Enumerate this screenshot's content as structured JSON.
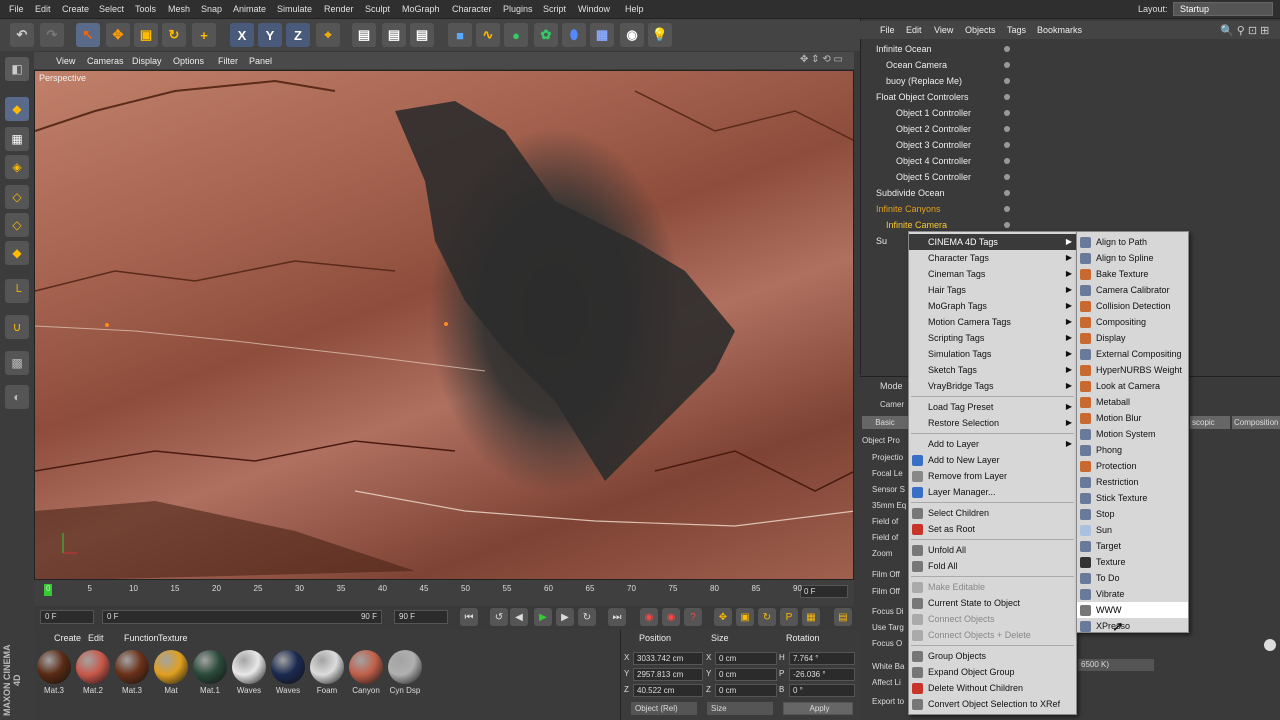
{
  "menubar": {
    "items": [
      "File",
      "Edit",
      "Create",
      "Select",
      "Tools",
      "Mesh",
      "Snap",
      "Animate",
      "Simulate",
      "Render",
      "Sculpt",
      "MoGraph",
      "Character",
      "Plugins",
      "Script",
      "Window",
      "Help"
    ],
    "layout_label": "Layout:",
    "layout_value": "Startup"
  },
  "viewport": {
    "menu": [
      "View",
      "Cameras",
      "Display",
      "Options",
      "Filter",
      "Panel"
    ],
    "label": "Perspective"
  },
  "timeline": {
    "ticks": [
      "0",
      "5",
      "10",
      "15",
      "20",
      "25",
      "30",
      "35",
      "40",
      "45",
      "50",
      "55",
      "60",
      "65",
      "70",
      "75",
      "80",
      "85",
      "90"
    ],
    "end_frame": "0 F"
  },
  "playbar": {
    "start": "0 F",
    "range_start": "0 F",
    "range_end": "90 F",
    "end": "90 F"
  },
  "materials": {
    "menu": [
      "Create",
      "Edit",
      "Function",
      "Texture"
    ],
    "items": [
      {
        "name": "Mat.3",
        "color": "#5a2a14"
      },
      {
        "name": "Mat.2",
        "color": "#c8584a"
      },
      {
        "name": "Mat.3",
        "color": "#6a3018"
      },
      {
        "name": "Mat",
        "color": "#e0a020"
      },
      {
        "name": "Mat.1",
        "color": "#2a4a3a"
      },
      {
        "name": "Waves",
        "color": "#e8e8e8"
      },
      {
        "name": "Waves",
        "color": "#1a2a50"
      },
      {
        "name": "Foam",
        "color": "#dcdcdc"
      },
      {
        "name": "Canyon",
        "color": "#c0604a"
      },
      {
        "name": "Cyn Dsp",
        "color": "#b0b0b0"
      }
    ]
  },
  "coords": {
    "headers": [
      "Position",
      "Size",
      "Rotation"
    ],
    "rows": [
      {
        "axis": "X",
        "pos": "3033.742 cm",
        "saxis": "X",
        "size": "0 cm",
        "raxis": "H",
        "rot": "7.764 °"
      },
      {
        "axis": "Y",
        "pos": "2957.813 cm",
        "saxis": "Y",
        "size": "0 cm",
        "raxis": "P",
        "rot": "-26.036 °"
      },
      {
        "axis": "Z",
        "pos": "40.522 cm",
        "saxis": "Z",
        "size": "0 cm",
        "raxis": "B",
        "rot": "0 °"
      }
    ],
    "mode1": "Object (Rel)",
    "mode2": "Size",
    "apply": "Apply"
  },
  "objmgr": {
    "menu": [
      "File",
      "Edit",
      "View",
      "Objects",
      "Tags",
      "Bookmarks"
    ],
    "rows": [
      "Infinite Ocean",
      "Ocean Camera",
      "buoy (Replace Me)",
      "Float Object Controlers",
      "Object 1 Controller",
      "Object 2 Controller",
      "Object 3 Controller",
      "Object 4 Controller",
      "Object 5 Controller",
      "Subdivide Ocean",
      "Infinite Canyons",
      "Infinite Camera",
      "Su"
    ]
  },
  "attr": {
    "mode": "Mode",
    "camera_tab": "Camer",
    "basic": "Basic",
    "tabs_right": [
      "scopic",
      "Composition"
    ],
    "labels": [
      "Object Pro",
      "Projectio",
      "Focal Le",
      "Sensor S",
      "35mm Eq",
      "Field of",
      "Field of",
      "Zoom",
      "Film Off",
      "Film Off",
      "Focus Di",
      "Use Targ",
      "Focus O",
      "White Ba",
      "Affect Li",
      "Export to"
    ],
    "kelvin": "6500 K)"
  },
  "ctx1": {
    "items": [
      {
        "label": "CINEMA 4D Tags",
        "arrow": true,
        "hl": true
      },
      {
        "label": "Character Tags",
        "arrow": true
      },
      {
        "label": "Cineman Tags",
        "arrow": true
      },
      {
        "label": "Hair Tags",
        "arrow": true
      },
      {
        "label": "MoGraph Tags",
        "arrow": true
      },
      {
        "label": "Motion Camera Tags",
        "arrow": true
      },
      {
        "label": "Scripting Tags",
        "arrow": true
      },
      {
        "label": "Simulation Tags",
        "arrow": true
      },
      {
        "label": "Sketch Tags",
        "arrow": true
      },
      {
        "label": "VrayBridge Tags",
        "arrow": true
      },
      {
        "sep": true
      },
      {
        "label": "Load Tag Preset",
        "arrow": true
      },
      {
        "label": "Restore Selection",
        "arrow": true
      },
      {
        "sep": true
      },
      {
        "label": "Add to Layer",
        "arrow": true
      },
      {
        "label": "Add to New Layer",
        "icon": "#3a6fc8"
      },
      {
        "label": "Remove from Layer",
        "icon": "#888"
      },
      {
        "label": "Layer Manager...",
        "icon": "#3a6fc8"
      },
      {
        "sep": true
      },
      {
        "label": "Select Children",
        "icon": "#777"
      },
      {
        "label": "Set as Root",
        "icon": "#c8342a"
      },
      {
        "sep": true
      },
      {
        "label": "Unfold All",
        "icon": "#777"
      },
      {
        "label": "Fold All",
        "icon": "#777"
      },
      {
        "sep": true
      },
      {
        "label": "Make Editable",
        "dis": true,
        "icon": "#aaa"
      },
      {
        "label": "Current State to Object",
        "icon": "#777"
      },
      {
        "label": "Connect Objects",
        "dis": true,
        "icon": "#aaa"
      },
      {
        "label": "Connect Objects + Delete",
        "dis": true,
        "icon": "#aaa"
      },
      {
        "sep": true
      },
      {
        "label": "Group Objects",
        "icon": "#777"
      },
      {
        "label": "Expand Object Group",
        "icon": "#777"
      },
      {
        "label": "Delete Without Children",
        "icon": "#c8342a"
      },
      {
        "label": "Convert Object Selection to XRef",
        "icon": "#777"
      }
    ]
  },
  "ctx2": {
    "items": [
      {
        "label": "Align to Path",
        "icon": "#6a7a9a"
      },
      {
        "label": "Align to Spline",
        "icon": "#6a7a9a"
      },
      {
        "label": "Bake Texture",
        "icon": "#c86a30"
      },
      {
        "label": "Camera Calibrator",
        "icon": "#6a7a9a"
      },
      {
        "label": "Collision Detection",
        "icon": "#c86a30"
      },
      {
        "label": "Compositing",
        "icon": "#c86a30"
      },
      {
        "label": "Display",
        "icon": "#c86a30"
      },
      {
        "label": "External Compositing",
        "icon": "#6a7a9a"
      },
      {
        "label": "HyperNURBS Weight",
        "icon": "#c86a30"
      },
      {
        "label": "Look at Camera",
        "icon": "#c86a30"
      },
      {
        "label": "Metaball",
        "icon": "#c86a30"
      },
      {
        "label": "Motion Blur",
        "icon": "#c86a30"
      },
      {
        "label": "Motion System",
        "icon": "#6a7a9a"
      },
      {
        "label": "Phong",
        "icon": "#6a7a9a"
      },
      {
        "label": "Protection",
        "icon": "#c86a30"
      },
      {
        "label": "Restriction",
        "icon": "#6a7a9a"
      },
      {
        "label": "Stick Texture",
        "icon": "#6a7a9a"
      },
      {
        "label": "Stop",
        "icon": "#6a7a9a"
      },
      {
        "label": "Sun",
        "icon": "#aac0e0"
      },
      {
        "label": "Target",
        "icon": "#6a7a9a"
      },
      {
        "label": "Texture",
        "icon": "#333"
      },
      {
        "label": "To Do",
        "icon": "#6a7a9a"
      },
      {
        "label": "Vibrate",
        "icon": "#6a7a9a"
      },
      {
        "label": "WWW",
        "icon": "#777",
        "sel": true
      },
      {
        "label": "XPresso",
        "icon": "#6a7a9a"
      }
    ]
  },
  "brand": "MAXON CINEMA 4D"
}
